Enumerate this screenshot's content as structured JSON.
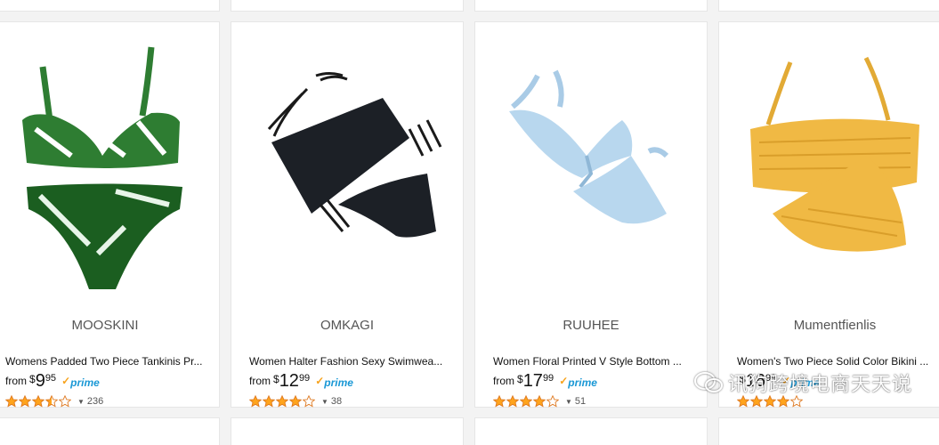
{
  "products": [
    {
      "brand": "MOOSKINI",
      "title": "Womens Padded Two Piece Tankinis Pr...",
      "from_label": "from",
      "currency": "$",
      "price_whole": "9",
      "price_fraction": "95",
      "prime_label": "prime",
      "rating": 3.5,
      "review_count": "236",
      "image_icon": "green-leaf-bikini-image"
    },
    {
      "brand": "OMKAGI",
      "title": "Women Halter Fashion Sexy Swimwea...",
      "from_label": "from",
      "currency": "$",
      "price_whole": "12",
      "price_fraction": "99",
      "prime_label": "prime",
      "rating": 4,
      "review_count": "38",
      "image_icon": "black-strappy-bikini-image"
    },
    {
      "brand": "RUUHEE",
      "title": "Women Floral Printed V Style Bottom ...",
      "from_label": "from",
      "currency": "$",
      "price_whole": "17",
      "price_fraction": "99",
      "prime_label": "prime",
      "rating": 4,
      "review_count": "51",
      "image_icon": "light-blue-tie-bikini-image"
    },
    {
      "brand": "Mumentfienlis",
      "title": "Women's Two Piece Solid Color Bikini ...",
      "from_label": "",
      "currency": "$",
      "price_whole": "16",
      "price_fraction": "99",
      "prime_label": "prime",
      "rating": 4,
      "review_count": "",
      "image_icon": "yellow-smocked-bikini-image"
    }
  ],
  "watermark": {
    "text": "讯狗跨境电商天天说",
    "icon": "wechat-icon"
  },
  "colors": {
    "star": "#ffa41c",
    "prime": "#1a98d5",
    "prime_check": "#f7a31c"
  }
}
